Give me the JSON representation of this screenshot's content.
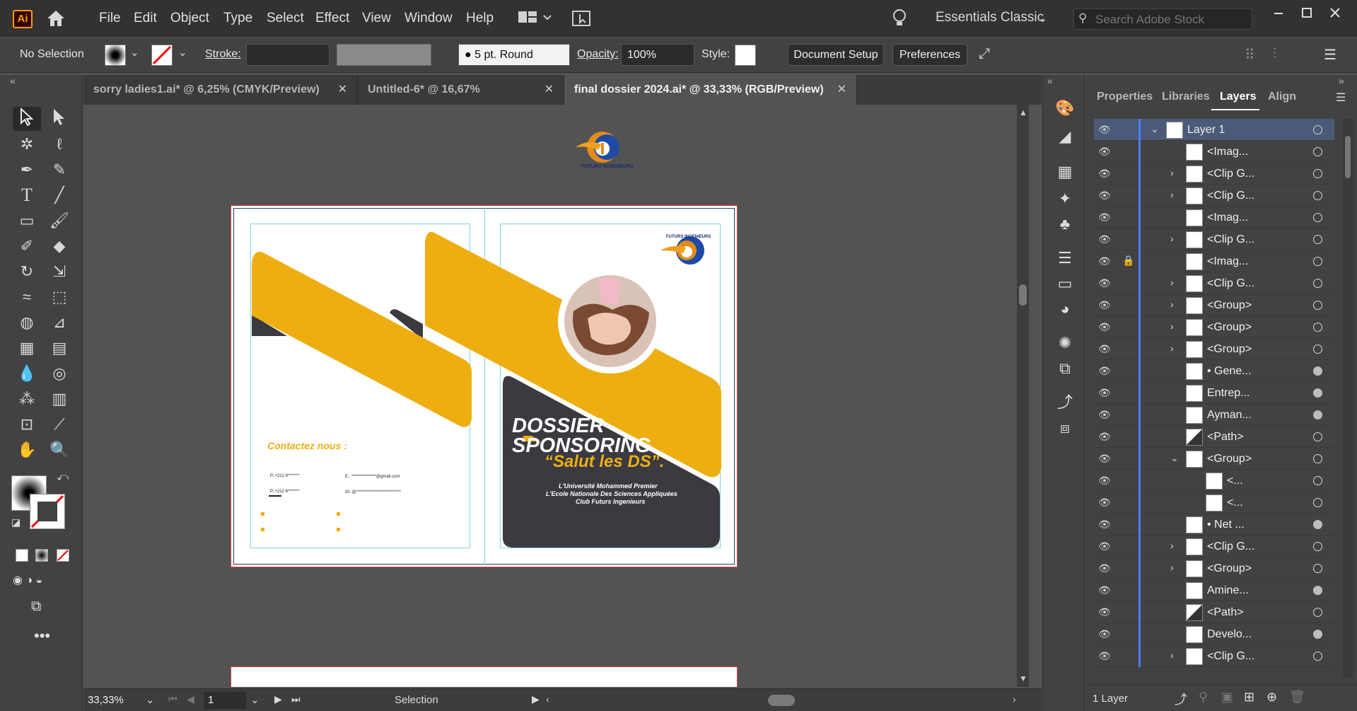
{
  "app": {
    "logo": "Ai"
  },
  "menu": [
    "File",
    "Edit",
    "Object",
    "Type",
    "Select",
    "Effect",
    "View",
    "Window",
    "Help"
  ],
  "workspace": "Essentials Classic",
  "search": {
    "placeholder": "Search Adobe Stock"
  },
  "control": {
    "selection": "No Selection",
    "stroke_label": "Stroke:",
    "brush": "5 pt. Round",
    "opacity_label": "Opacity:",
    "opacity_value": "100%",
    "style_label": "Style:",
    "document_setup": "Document Setup",
    "preferences": "Preferences"
  },
  "tabs": [
    {
      "label": "sorry ladies1.ai* @ 6,25% (CMYK/Preview)"
    },
    {
      "label": "Untitled-6* @ 16,67% (CMYK/Preview)"
    },
    {
      "label": "final dossier 2024.ai* @ 33,33% (RGB/Preview)"
    }
  ],
  "status": {
    "zoom": "33,33%",
    "artboard": "1",
    "mode": "Selection"
  },
  "panel_tabs": [
    "Properties",
    "Libraries",
    "Layers",
    "Align"
  ],
  "layers": [
    {
      "name": "Layer 1"
    },
    {
      "name": "<Imag..."
    },
    {
      "name": "<Clip G..."
    },
    {
      "name": "<Clip G..."
    },
    {
      "name": "<Imag..."
    },
    {
      "name": "<Clip G..."
    },
    {
      "name": "<Imag..."
    },
    {
      "name": "<Clip G..."
    },
    {
      "name": "<Group>"
    },
    {
      "name": "<Group>"
    },
    {
      "name": "<Group>"
    },
    {
      "name": "• Gene..."
    },
    {
      "name": "Entrep..."
    },
    {
      "name": "Ayman..."
    },
    {
      "name": "<Path>"
    },
    {
      "name": "<Group>"
    },
    {
      "name": "<..."
    },
    {
      "name": "<..."
    },
    {
      "name": "• Net ..."
    },
    {
      "name": "<Clip G..."
    },
    {
      "name": "<Group>"
    },
    {
      "name": "Amine..."
    },
    {
      "name": "<Path>"
    },
    {
      "name": "Develo..."
    },
    {
      "name": "<Clip G..."
    }
  ],
  "layers_footer": "1 Layer",
  "artwork": {
    "logo_caption": "FUTURS INGENIEURS",
    "contact_title": "Contactez nous :",
    "contact_phone1": "P.:+212 6*******",
    "contact_phone2": "P.:+212 6*******",
    "contact_email": "E.: ***************@gmail.com",
    "contact_ig": "IG: @***************************",
    "title_line1": "DOSSIER",
    "title_line2": "SPONSORING",
    "slogan": "“Salut les DS”.",
    "uni_line1": "L'Université Mohammed Premier",
    "uni_line2": "L'Ecole Nationale Des Sciences Appliquées",
    "uni_line3": "Club Futurs Ingenieurs"
  },
  "colors": {
    "accent": "#eeae11",
    "dark": "#3a3a40",
    "guide": "#7fd3d8",
    "bleed": "#e23b3b"
  }
}
